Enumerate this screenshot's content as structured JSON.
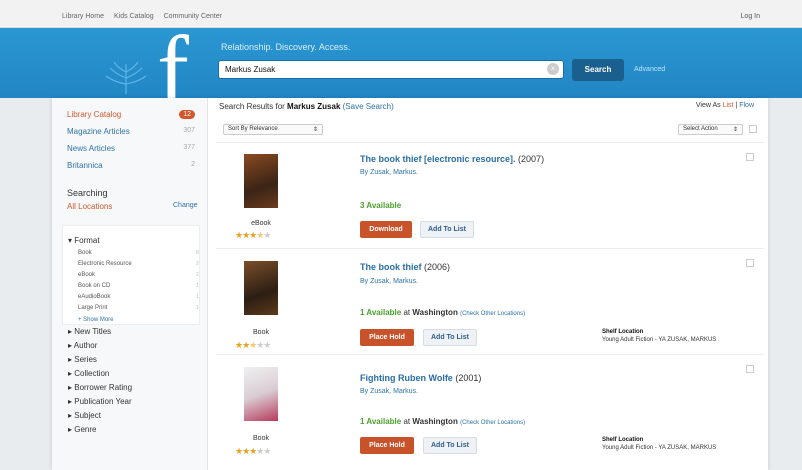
{
  "topnav": {
    "links": [
      "Library Home",
      "Kids Catalog",
      "Community Center"
    ],
    "login": "Log In"
  },
  "banner": {
    "tagline": "Relationship. Discovery. Access."
  },
  "search": {
    "query": "Markus Zusak",
    "button": "Search",
    "advanced": "Advanced"
  },
  "sidebar": {
    "categories": [
      {
        "label": "Library Catalog",
        "count": "12"
      },
      {
        "label": "Magazine Articles",
        "count": "307"
      },
      {
        "label": "News Articles",
        "count": "377"
      },
      {
        "label": "Britannica",
        "count": "2"
      }
    ],
    "searching_label": "Searching",
    "locations": "All Locations",
    "change": "Change",
    "format_head": "Format",
    "formats": [
      {
        "label": "Book",
        "count": "8"
      },
      {
        "label": "Electronic Resource",
        "count": "2"
      },
      {
        "label": "eBook",
        "count": "2"
      },
      {
        "label": "Book on CD",
        "count": "1"
      },
      {
        "label": "eAudioBook",
        "count": "1"
      },
      {
        "label": "Large Print",
        "count": "1"
      }
    ],
    "show_more": "+ Show More",
    "facets": [
      "New Titles",
      "Author",
      "Series",
      "Collection",
      "Borrower Rating",
      "Publication Year",
      "Subject",
      "Genre"
    ]
  },
  "results": {
    "prefix": "Search Results for",
    "query": "Markus Zusak",
    "save": "(Save Search)",
    "view_as": "View As",
    "view_list": "List",
    "view_flow": "Flow",
    "sort": "Sort By Relevance",
    "select_action": "Select Action",
    "items": [
      {
        "title": "The book thief [electronic resource].",
        "year": "(2007)",
        "author": "By Zusak, Markus.",
        "format": "eBook",
        "stars": 3.5,
        "available": "3 Available",
        "location_prefix": "",
        "location": "",
        "check": "",
        "primary_btn": "Download",
        "list_btn": "Add To List",
        "shelf_label": "",
        "shelf_value": ""
      },
      {
        "title": "The book thief",
        "year": "(2006)",
        "author": "By Zusak, Markus.",
        "format": "Book",
        "stars": 2.5,
        "available": "1 Available",
        "location_prefix": "at",
        "location": "Washington",
        "check": "(Check Other Locations)",
        "primary_btn": "Place Hold",
        "list_btn": "Add To List",
        "shelf_label": "Shelf Location",
        "shelf_value": "Young Adult Fiction - YA ZUSAK, MARKUS"
      },
      {
        "title": "Fighting Ruben Wolfe",
        "year": "(2001)",
        "author": "By Zusak, Markus.",
        "format": "Book",
        "stars": 3,
        "available": "1 Available",
        "location_prefix": "at",
        "location": "Washington",
        "check": "(Check Other Locations)",
        "primary_btn": "Place Hold",
        "list_btn": "Add To List",
        "shelf_label": "Shelf Location",
        "shelf_value": "Young Adult Fiction - YA ZUSAK, MARKUS"
      }
    ]
  },
  "colors": {
    "banner": "#2286c4",
    "accent": "#d05a2f",
    "link": "#2d73a5",
    "available": "#4aa12c",
    "button": "#c8532a"
  },
  "icons": {
    "logo": "library-logo-f",
    "wheat": "wheat-icon",
    "clear": "clear-search-icon",
    "star": "star-icon"
  }
}
